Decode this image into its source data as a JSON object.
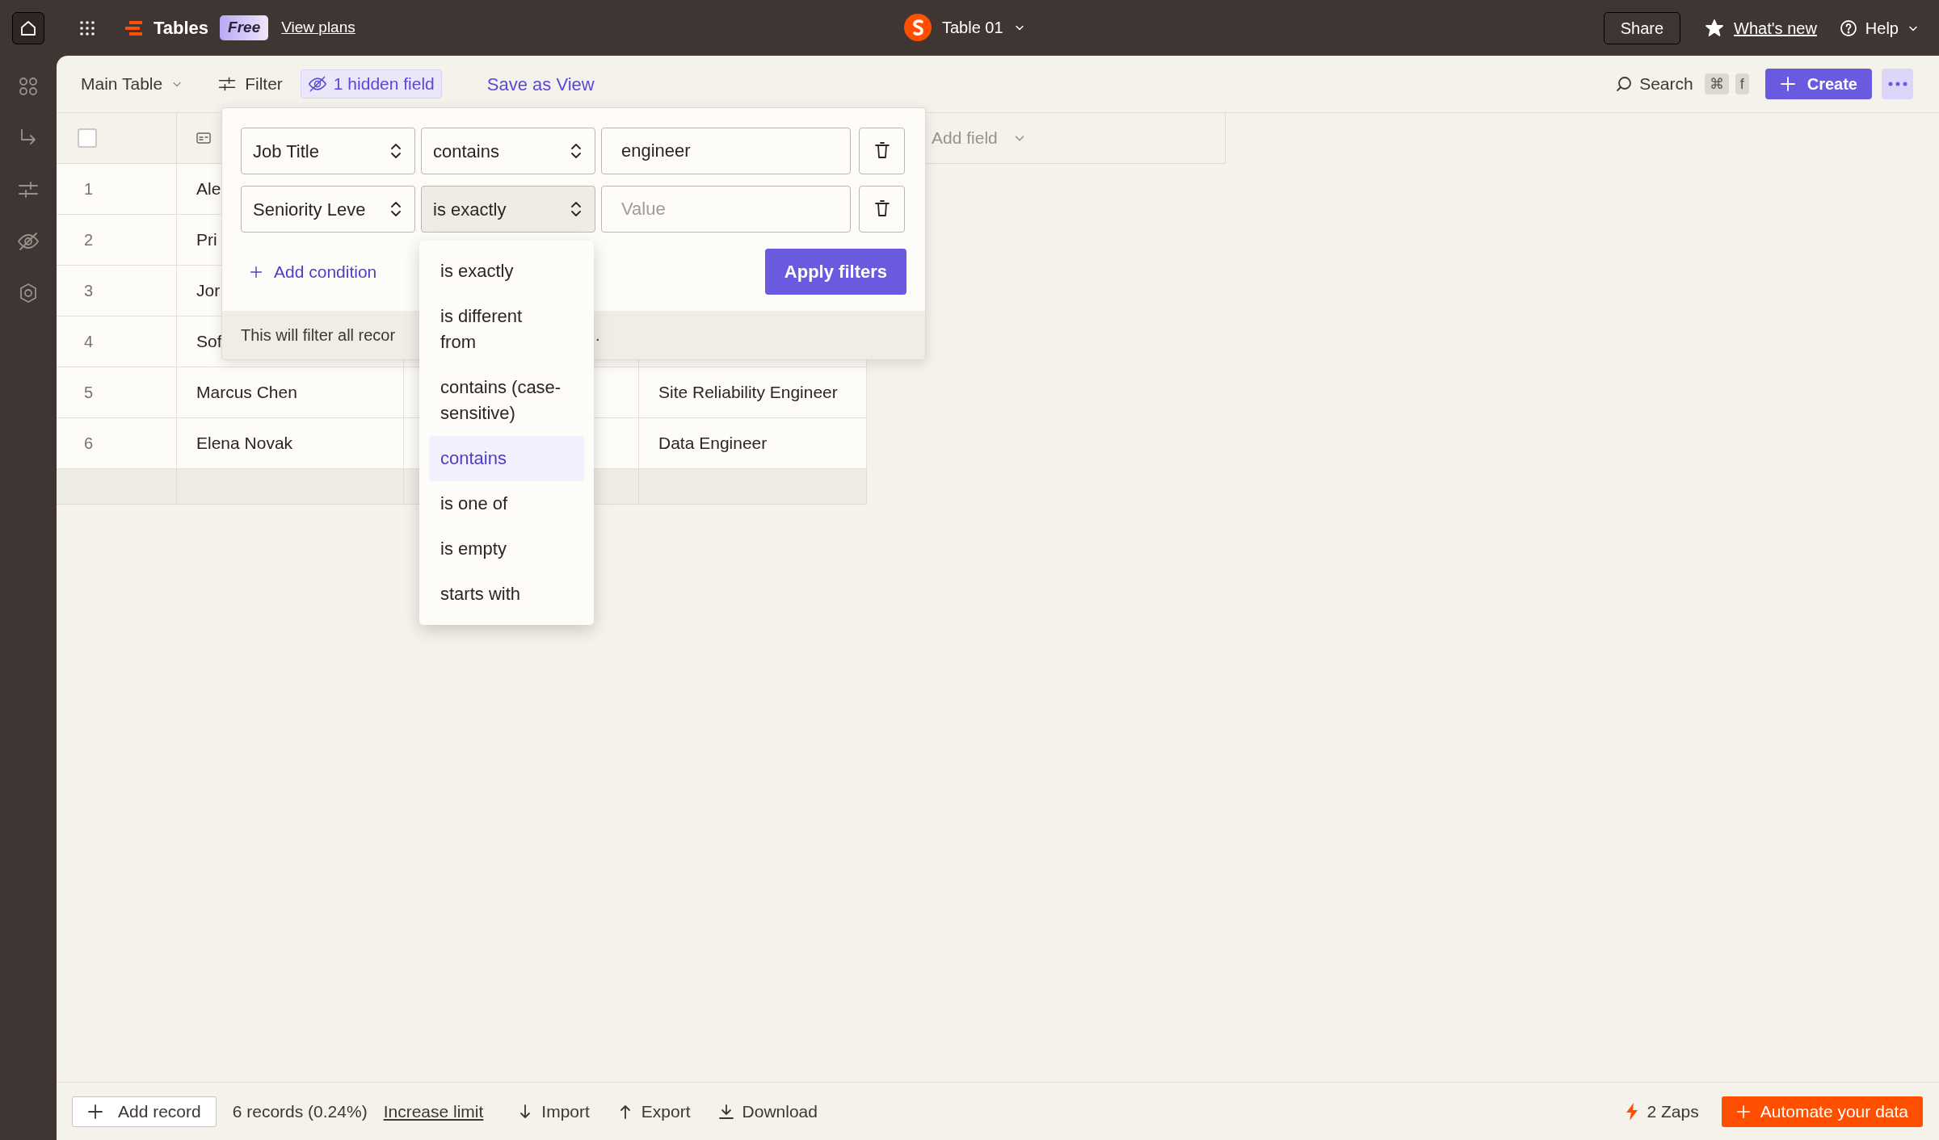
{
  "topbar": {
    "app_name": "Tables",
    "plan_badge": "Free",
    "plans_link": "View plans",
    "table_name": "Table 01",
    "share": "Share",
    "whats_new": "What's new",
    "help": "Help"
  },
  "toolbar": {
    "view": "Main Table",
    "filter": "Filter",
    "hidden_fields": "1 hidden field",
    "save_view": "Save as View",
    "search": "Search",
    "shortcut": [
      "⌘",
      "f"
    ],
    "create": "Create"
  },
  "table": {
    "select_all_checked": false,
    "add_field": "Add field",
    "rows": [
      {
        "number": "1",
        "name": "Ale"
      },
      {
        "number": "2",
        "name": "Pri"
      },
      {
        "number": "3",
        "name": "Jor"
      },
      {
        "number": "4",
        "name": "Sof"
      },
      {
        "number": "5",
        "name": "Marcus Chen",
        "column_4": "Site Reliability Engineer"
      },
      {
        "number": "6",
        "name": "Elena Novak",
        "column_4": "Data Engineer"
      }
    ]
  },
  "filter_panel": {
    "conditions": [
      {
        "field": "Job Title",
        "operator": "contains",
        "operator_open": false,
        "value": "engineer"
      },
      {
        "field": "Seniority Leve",
        "operator": "is exactly",
        "operator_open": true,
        "placeholder": "Value"
      }
    ],
    "add_condition": "Add condition",
    "apply": "Apply filters",
    "note_start": "This will filter all recor",
    "note_end": "."
  },
  "operator_menu": {
    "options": [
      {
        "label": "is exactly",
        "selected": false
      },
      {
        "label": "is different from",
        "selected": false
      },
      {
        "label": "contains (case-sensitive)",
        "selected": false
      },
      {
        "label": "contains",
        "selected": true
      },
      {
        "label": "is one of",
        "selected": false
      },
      {
        "label": "is empty",
        "selected": false
      },
      {
        "label": "starts with",
        "selected": false
      }
    ]
  },
  "footer": {
    "add_record": "Add record",
    "record_count": "6 records (0.24%)",
    "increase_limit": "Increase limit",
    "import": "Import",
    "export": "Export",
    "download": "Download",
    "zaps": "2 Zaps",
    "automate": "Automate your data"
  }
}
